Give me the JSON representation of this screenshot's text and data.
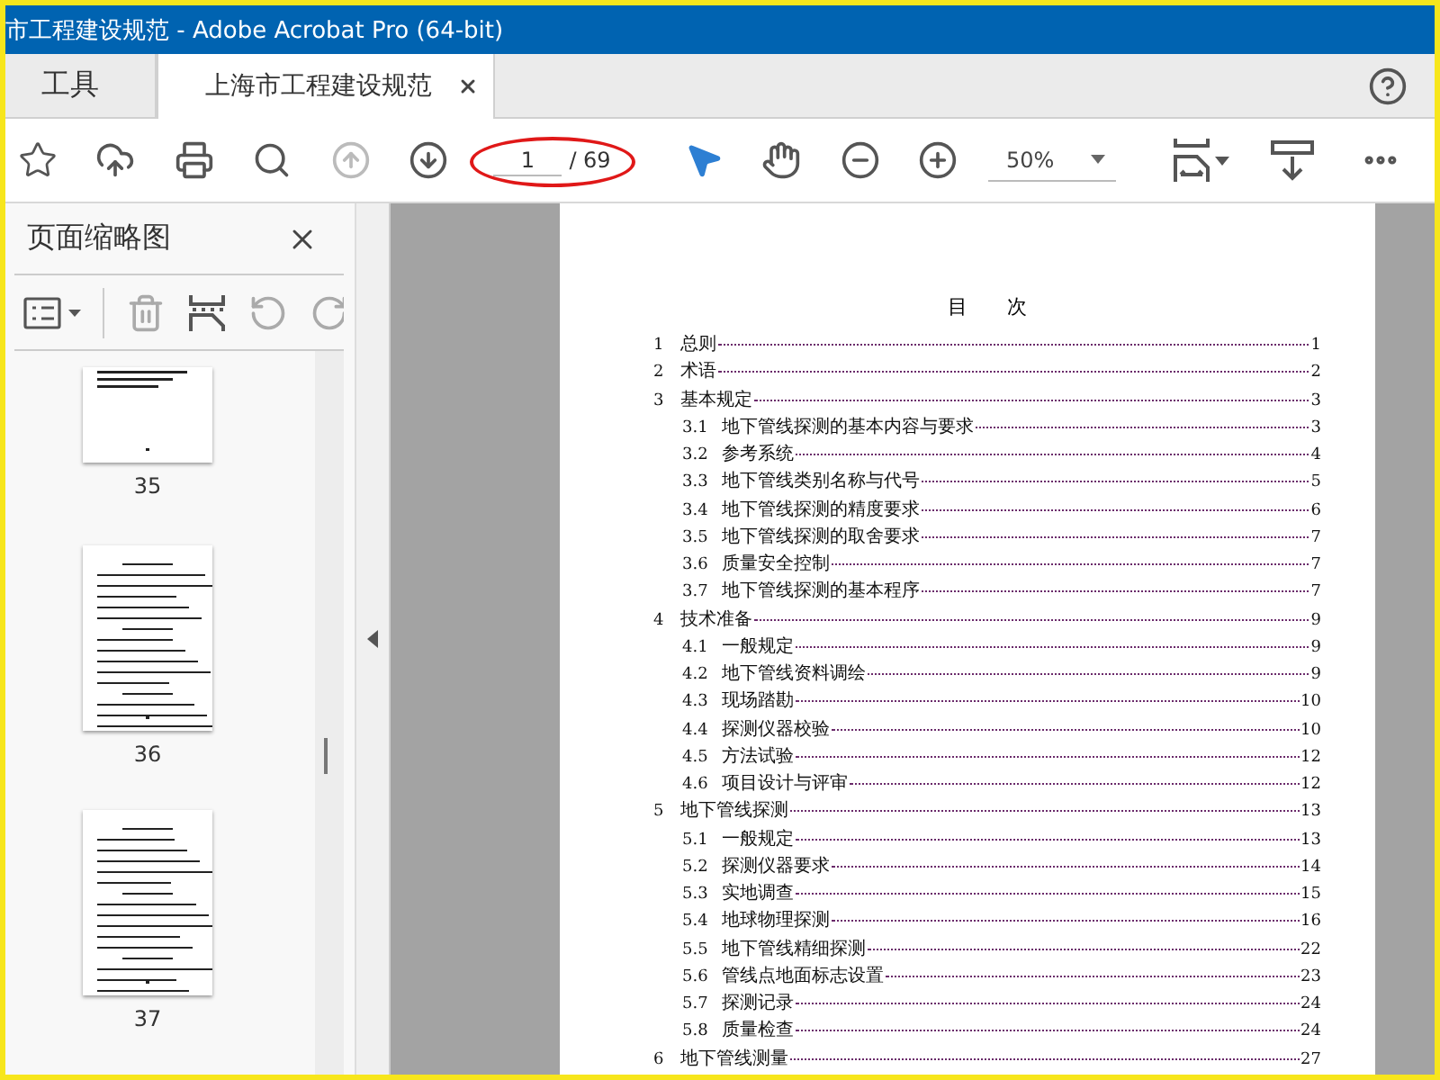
{
  "window": {
    "title": "市工程建设规范 - Adobe Acrobat Pro (64-bit)"
  },
  "tabs": [
    {
      "label": "工具",
      "selected": false
    },
    {
      "label": "上海市工程建设规范",
      "selected": true
    }
  ],
  "toolbar": {
    "nav_buttons": [
      {
        "disabled": true
      },
      {
        "disabled": false
      }
    ],
    "page_field": {
      "value": "1",
      "total": "/ 69"
    },
    "tools": [
      {
        "selected": true
      },
      {
        "selected": false
      }
    ],
    "zoom": {
      "value": "50%"
    }
  },
  "sidebar": {
    "title": "页面缩略图",
    "thumbnails": [
      {
        "label": "35"
      },
      {
        "label": "36"
      },
      {
        "label": "37"
      }
    ]
  },
  "document": {
    "heading": "目　　次",
    "toc": [
      {
        "number": "1",
        "title": "总则",
        "page": "1"
      },
      {
        "number": "2",
        "title": "术语",
        "page": "2"
      },
      {
        "number": "3",
        "title": "基本规定",
        "page": "3",
        "children": [
          {
            "number": "3.1",
            "title": "地下管线探测的基本内容与要求",
            "page": "3"
          },
          {
            "number": "3.2",
            "title": "参考系统",
            "page": "4"
          },
          {
            "number": "3.3",
            "title": "地下管线类别名称与代号",
            "page": "5"
          },
          {
            "number": "3.4",
            "title": "地下管线探测的精度要求",
            "page": "6"
          },
          {
            "number": "3.5",
            "title": "地下管线探测的取舍要求",
            "page": "7"
          },
          {
            "number": "3.6",
            "title": "质量安全控制",
            "page": "7"
          },
          {
            "number": "3.7",
            "title": "地下管线探测的基本程序",
            "page": "7"
          }
        ]
      },
      {
        "number": "4",
        "title": "技术准备",
        "page": "9",
        "children": [
          {
            "number": "4.1",
            "title": "一般规定",
            "page": "9"
          },
          {
            "number": "4.2",
            "title": "地下管线资料调绘",
            "page": "9"
          },
          {
            "number": "4.3",
            "title": "现场踏勘",
            "page": "10"
          },
          {
            "number": "4.4",
            "title": "探测仪器校验",
            "page": "10"
          },
          {
            "number": "4.5",
            "title": "方法试验",
            "page": "12"
          },
          {
            "number": "4.6",
            "title": "项目设计与评审",
            "page": "12"
          }
        ]
      },
      {
        "number": "5",
        "title": "地下管线探测",
        "page": "13",
        "children": [
          {
            "number": "5.1",
            "title": "一般规定",
            "page": "13"
          },
          {
            "number": "5.2",
            "title": "探测仪器要求",
            "page": "14"
          },
          {
            "number": "5.3",
            "title": "实地调查",
            "page": "15"
          },
          {
            "number": "5.4",
            "title": "地球物理探测",
            "page": "16"
          },
          {
            "number": "5.5",
            "title": "地下管线精细探测",
            "page": "22"
          },
          {
            "number": "5.6",
            "title": "管线点地面标志设置",
            "page": "23"
          },
          {
            "number": "5.7",
            "title": "探测记录",
            "page": "24"
          },
          {
            "number": "5.8",
            "title": "质量检查",
            "page": "24"
          }
        ]
      },
      {
        "number": "6",
        "title": "地下管线测量",
        "page": "27"
      }
    ]
  }
}
